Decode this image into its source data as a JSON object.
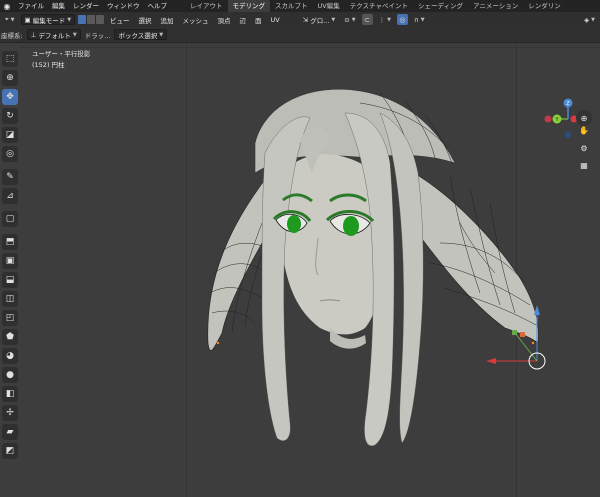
{
  "menubar": {
    "items": [
      "ファイル",
      "編集",
      "レンダー",
      "ウィンドウ",
      "ヘルプ"
    ],
    "workspaces": [
      "レイアウト",
      "モデリング",
      "スカルプト",
      "UV編集",
      "テクスチャペイント",
      "シェーディング",
      "アニメーション",
      "レンダリン"
    ],
    "active_workspace": "モデリング"
  },
  "header": {
    "mode": "編集モード",
    "menus": [
      "ビュー",
      "選択",
      "追加",
      "メッシュ",
      "頂点",
      "辺",
      "面",
      "UV"
    ],
    "orientation": "グロ..."
  },
  "tool_settings": {
    "coord_label": "座標系:",
    "coord_value": "デフォルト",
    "drag_label": "ドラッ...",
    "select_mode": "ボックス選択"
  },
  "viewport": {
    "view_name": "ユーザー・平行投影",
    "object_info": "(152) 円柱"
  },
  "gizmo": {
    "axis_z": "Z",
    "axis_y": "Y"
  },
  "colors": {
    "accent": "#4772b3",
    "eye_green": "#1e9a1e",
    "mesh_body": "#c9c9c3"
  },
  "icons": {
    "tools": [
      "select-box-icon",
      "cursor-icon",
      "move-icon",
      "rotate-icon",
      "scale-icon",
      "transform-icon",
      "annotate-icon",
      "measure-icon",
      "add-cube-icon",
      "extrude-icon",
      "inset-icon",
      "bevel-icon",
      "loop-cut-icon",
      "knife-icon",
      "poly-build-icon",
      "spin-icon",
      "smooth-icon",
      "edge-slide-icon",
      "shrink-icon",
      "shear-icon",
      "rip-icon"
    ],
    "nav": [
      "zoom-icon",
      "hand-pan-icon",
      "camera-icon",
      "grid-icon"
    ]
  }
}
